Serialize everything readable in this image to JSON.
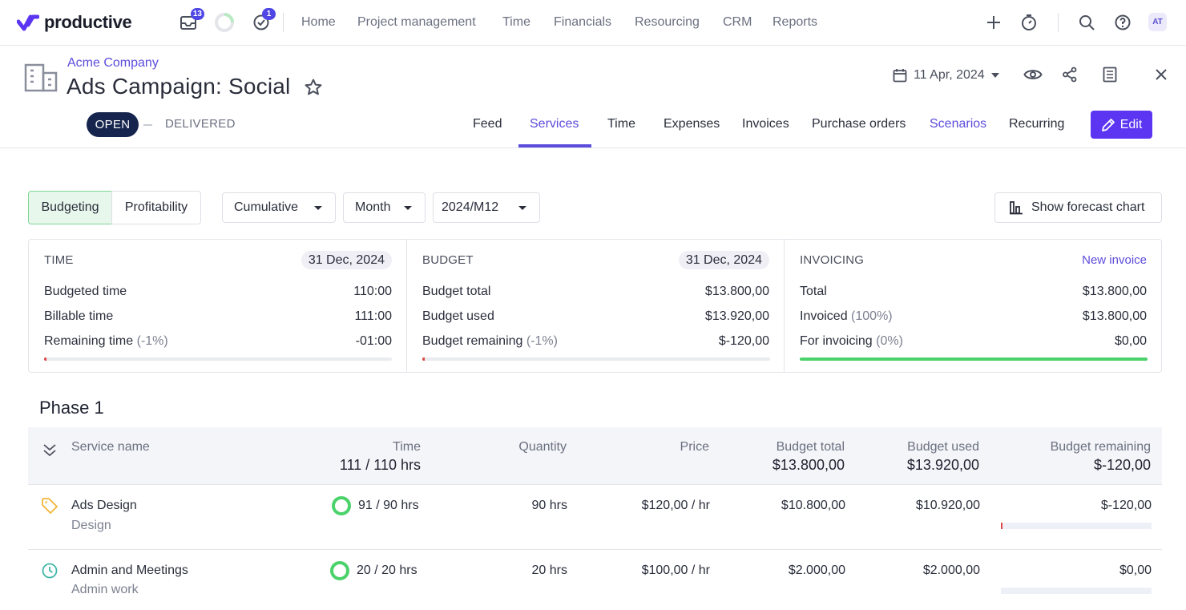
{
  "app": {
    "brand": "productive",
    "inbox_badge": "13",
    "tasks_badge": "1",
    "nav": [
      "Home",
      "Project management",
      "Time",
      "Financials",
      "Resourcing",
      "CRM",
      "Reports"
    ],
    "avatar_initials": "AT",
    "icons": [
      "inbox-icon",
      "timer-progress-icon",
      "check-circle-icon",
      "plus-icon",
      "stopwatch-icon",
      "search-icon",
      "help-icon"
    ]
  },
  "project": {
    "company": "Acme Company",
    "title": "Ads Campaign: Social",
    "date": "11 Apr, 2024",
    "status_open": "OPEN",
    "status_delivered": "DELIVERED",
    "tabs": [
      "Feed",
      "Services",
      "Time",
      "Expenses",
      "Invoices",
      "Purchase orders",
      "Scenarios",
      "Recurring"
    ],
    "active_tab": "Services",
    "edit_label": "Edit"
  },
  "filters": {
    "view_budgeting": "Budgeting",
    "view_profitability": "Profitability",
    "mode": "Cumulative",
    "period": "Month",
    "month": "2024/M12",
    "forecast_label": "Show forecast chart"
  },
  "cards": {
    "time": {
      "title": "TIME",
      "date": "31 Dec, 2024",
      "rows": [
        {
          "label": "Budgeted time",
          "note": "",
          "value": "110:00"
        },
        {
          "label": "Billable time",
          "note": "",
          "value": "111:00"
        },
        {
          "label": "Remaining time",
          "note": "(-1%)",
          "value": "-01:00"
        }
      ],
      "progress_color": "#e04646"
    },
    "budget": {
      "title": "BUDGET",
      "date": "31 Dec, 2024",
      "rows": [
        {
          "label": "Budget total",
          "note": "",
          "value": "$13.800,00"
        },
        {
          "label": "Budget used",
          "note": "",
          "value": "$13.920,00"
        },
        {
          "label": "Budget remaining",
          "note": "(-1%)",
          "value": "$-120,00"
        }
      ],
      "progress_color": "#e04646"
    },
    "invoicing": {
      "title": "INVOICING",
      "link": "New invoice",
      "rows": [
        {
          "label": "Total",
          "note": "",
          "value": "$13.800,00"
        },
        {
          "label": "Invoiced",
          "note": "(100%)",
          "value": "$13.800,00"
        },
        {
          "label": "For invoicing",
          "note": "(0%)",
          "value": "$0,00"
        }
      ],
      "progress": 1.0,
      "progress_color": "#4cd26b"
    }
  },
  "phase": {
    "title": "Phase 1",
    "columns": {
      "service_name": "Service name",
      "time": "Time",
      "quantity": "Quantity",
      "price": "Price",
      "budget_total": "Budget total",
      "budget_used": "Budget used",
      "budget_remaining": "Budget remaining"
    },
    "totals": {
      "time": "111 / 110 hrs",
      "budget_total": "$13.800,00",
      "budget_used": "$13.920,00",
      "budget_remaining": "$-120,00"
    },
    "services": [
      {
        "name": "Ads Design",
        "type": "Design",
        "icon": "tag-icon",
        "time": "91 / 90 hrs",
        "quantity": "90 hrs",
        "price": "$120,00 / hr",
        "budget_total": "$10.800,00",
        "budget_used": "$10.920,00",
        "budget_remaining": "$-120,00"
      },
      {
        "name": "Admin and Meetings",
        "type": "Admin work",
        "icon": "clock-icon",
        "time": "20 / 20 hrs",
        "quantity": "20 hrs",
        "price": "$100,00 / hr",
        "budget_total": "$2.000,00",
        "budget_used": "$2.000,00",
        "budget_remaining": "$0,00"
      }
    ]
  }
}
